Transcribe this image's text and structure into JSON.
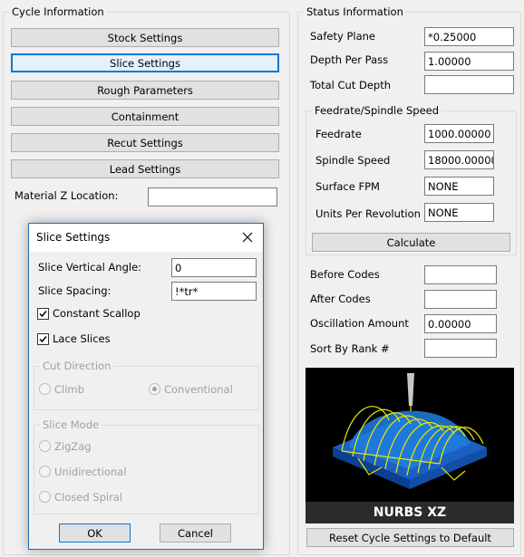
{
  "cycle_info": {
    "title": "Cycle Information",
    "buttons": {
      "stock": "Stock Settings",
      "slice": "Slice Settings",
      "rough": "Rough Parameters",
      "containment": "Containment",
      "recut": "Recut Settings",
      "lead": "Lead Settings"
    },
    "material_z_label": "Material Z Location:",
    "material_z_value": ""
  },
  "status_info": {
    "title": "Status Information",
    "safety_plane_label": "Safety Plane",
    "safety_plane_value": "*0.25000",
    "depth_per_pass_label": "Depth Per Pass",
    "depth_per_pass_value": "1.00000",
    "total_cut_depth_label": "Total Cut Depth",
    "total_cut_depth_value": "",
    "feedrate_group": {
      "title": "Feedrate/Spindle Speed",
      "feedrate_label": "Feedrate",
      "feedrate_value": "1000.00000",
      "spindle_label": "Spindle Speed",
      "spindle_value": "18000.00000",
      "surface_fpm_label": "Surface FPM",
      "surface_fpm_value": "NONE",
      "units_per_rev_label": "Units Per Revolution",
      "units_per_rev_value": "NONE",
      "calculate_label": "Calculate"
    },
    "before_codes_label": "Before Codes",
    "before_codes_value": "",
    "after_codes_label": "After Codes",
    "after_codes_value": "",
    "oscillation_label": "Oscillation Amount",
    "oscillation_value": "0.00000",
    "sort_rank_label": "Sort By Rank #",
    "sort_rank_value": "",
    "preview_caption": "NURBS XZ",
    "reset_label": "Reset Cycle Settings to Default"
  },
  "dialog": {
    "title": "Slice Settings",
    "vertical_angle_label": "Slice Vertical Angle:",
    "vertical_angle_value": "0",
    "spacing_label": "Slice Spacing:",
    "spacing_value": "!*tr*",
    "constant_scallop_label": "Constant Scallop",
    "constant_scallop_checked": true,
    "lace_slices_label": "Lace Slices",
    "lace_slices_checked": true,
    "cut_direction": {
      "title": "Cut Direction",
      "climb": "Climb",
      "conventional": "Conventional",
      "selected": "Conventional"
    },
    "slice_mode": {
      "title": "Slice Mode",
      "zigzag": "ZigZag",
      "unidirectional": "Unidirectional",
      "closed_spiral": "Closed Spiral"
    },
    "ok_label": "OK",
    "cancel_label": "Cancel"
  },
  "colors": {
    "accent": "#0078d7",
    "preview_wire": "#e8e800",
    "preview_block": "#1a6fd6"
  }
}
